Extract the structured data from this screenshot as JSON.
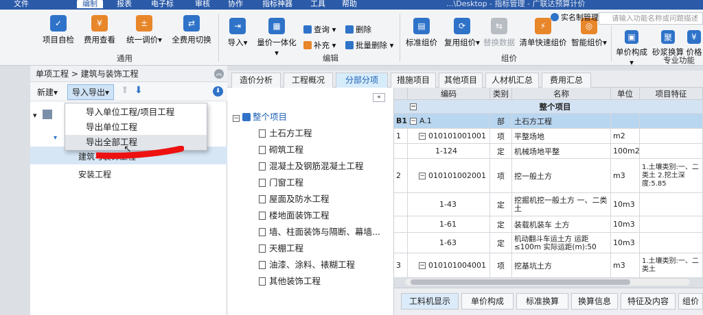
{
  "menu": {
    "items": [
      "文件",
      "编制",
      "报表",
      "电子标",
      "审核",
      "协作",
      "指标神器",
      "工具",
      "帮助"
    ],
    "title": "...\\Desktop - 指标管理 - 广联达预算计价",
    "active": "编制"
  },
  "ribbon": {
    "general": {
      "buttons": [
        "项目自检",
        "费用查看",
        "统一调价",
        "全费用切换"
      ],
      "label": "通用"
    },
    "edit": {
      "import": "导入",
      "quota": "量价一体化",
      "query": "查询",
      "supplement": "补充",
      "delete": "删除",
      "batch_delete": "批量删除",
      "label": "编辑"
    },
    "price": {
      "buttons": [
        "标准组价",
        "复用组价",
        "替换数据",
        "清单快速组价",
        "智能组价"
      ],
      "label": "组价"
    },
    "special": {
      "buttons": [
        "单价构成",
        "砂浆换算",
        "价格"
      ],
      "label": "专业功能"
    },
    "realname": "实名制管理",
    "search_placeholder": "请输入功能名称或问题描述"
  },
  "left": {
    "breadcrumb": "单项工程 > 建筑与装饰工程",
    "new_btn": "新建",
    "import_export_btn": "导入导出",
    "tree": {
      "root_item": "建筑与装饰工程",
      "install": "安装工程"
    }
  },
  "dropdown": {
    "items": [
      "导入单位工程/项目工程",
      "导出单位工程",
      "导出全部工程"
    ]
  },
  "tabs": [
    "造价分析",
    "工程概况",
    "分部分项",
    "措施项目",
    "其他项目",
    "人材机汇总",
    "费用汇总"
  ],
  "active_tab": "分部分项",
  "tree": {
    "root": "整个项目",
    "items": [
      "土石方工程",
      "砌筑工程",
      "混凝土及钢筋混凝土工程",
      "门窗工程",
      "屋面及防水工程",
      "楼地面装饰工程",
      "墙、柱面装饰与隔断、幕墙...",
      "天棚工程",
      "油漆、涂料、裱糊工程",
      "其他装饰工程"
    ]
  },
  "grid": {
    "headers": [
      "编码",
      "类别",
      "名称",
      "单位",
      "项目特征"
    ],
    "whole_row": "整个项目",
    "rows": [
      {
        "idx": "B1",
        "code": "A.1",
        "type": "部",
        "name": "土石方工程",
        "unit": "",
        "feature": ""
      },
      {
        "idx": "1",
        "code": "010101001001",
        "type": "项",
        "name": "平整场地",
        "unit": "m2",
        "feature": ""
      },
      {
        "idx": "",
        "code": "1-124",
        "type": "定",
        "name": "机械场地平整",
        "unit": "100m2",
        "feature": ""
      },
      {
        "idx": "2",
        "code": "010101002001",
        "type": "项",
        "name": "挖一般土方",
        "unit": "m3",
        "feature": "1.土壤类别:一、二类土 2.挖土深度:5.85"
      },
      {
        "idx": "",
        "code": "1-43",
        "type": "定",
        "name": "挖掘机挖一般土方 一、二类土",
        "unit": "10m3",
        "feature": ""
      },
      {
        "idx": "",
        "code": "1-61",
        "type": "定",
        "name": "装载机装车 土方",
        "unit": "10m3",
        "feature": ""
      },
      {
        "idx": "",
        "code": "1-63",
        "type": "定",
        "name": "机动翻斗车运土方 运距≤100m 实际运距(m):50",
        "unit": "10m3",
        "feature": ""
      },
      {
        "idx": "3",
        "code": "010101004001",
        "type": "项",
        "name": "挖基坑土方",
        "unit": "m3",
        "feature": "1.土壤类别:一、二类土"
      }
    ]
  },
  "bottom_tabs": [
    "工料机显示",
    "单价构成",
    "标准换算",
    "换算信息",
    "特征及内容",
    "组价方"
  ]
}
